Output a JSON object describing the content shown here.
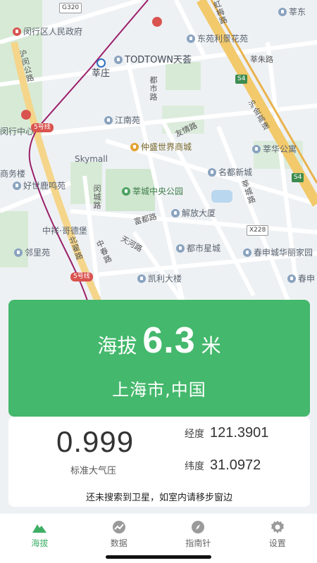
{
  "map": {
    "labels": {
      "minhang_gov": "闵行区人民政府",
      "xinzhuang": "莘庄",
      "todtown": "TODTOWN天荟",
      "xindong": "莘东",
      "dongyuan": "东苑利景花苑",
      "xinzhulu": "莘朱路",
      "jiangnan": "江南苑",
      "zhongsheng": "仲盛世界商城",
      "skymall": "Skymall",
      "xinhua": "莘华公寓",
      "mingdu": "名都新城",
      "haoshi": "好世鹿鸣苑",
      "xincheng_park": "莘城中央公园",
      "jiefang": "解放大厦",
      "zhongxiang": "中祥·哥德堡",
      "linli": "邻里苑",
      "dushi": "都市星城",
      "chunshen": "春申城华丽家园",
      "kaili": "凯利大楼",
      "chunshen2": "春申",
      "shangwu": "商务楼",
      "minhang_center": "闵行中心",
      "fudu_road": "富都路",
      "tianhe_road": "天河路",
      "dushi_road": "都市路",
      "youqing_road": "友情路",
      "shenhu_road": "沪闵公路",
      "hujin_highway": "沪金高速",
      "xincheng_road": "莘城路",
      "beiqiao": "北翟路",
      "minjie": "闵城路",
      "huhong": "虹梅路",
      "zhongchun": "中春路"
    },
    "badges": {
      "metro5": "5号线",
      "metro5b": "5号线",
      "g320": "G320",
      "s4": "S4",
      "s4b": "S4",
      "x228": "X228"
    }
  },
  "altitude": {
    "prefix": "海拔",
    "value": "6.3",
    "unit": "米",
    "location": "上海市,中国"
  },
  "info": {
    "pressure_value": "0.999",
    "pressure_label": "标准大气压",
    "longitude_label": "经度",
    "longitude_value": "121.3901",
    "latitude_label": "纬度",
    "latitude_value": "31.0972",
    "gps_status": "还未搜索到卫星，如室内请移步窗边"
  },
  "nav": {
    "items": [
      {
        "label": "海拔",
        "icon": "mountain-icon",
        "active": true
      },
      {
        "label": "数据",
        "icon": "chart-icon",
        "active": false
      },
      {
        "label": "指南针",
        "icon": "compass-icon",
        "active": false
      },
      {
        "label": "设置",
        "icon": "gear-icon",
        "active": false
      }
    ]
  },
  "colors": {
    "accent": "#44b86c",
    "nav_active": "#3fae65",
    "map_bg": "#eef1f4"
  }
}
